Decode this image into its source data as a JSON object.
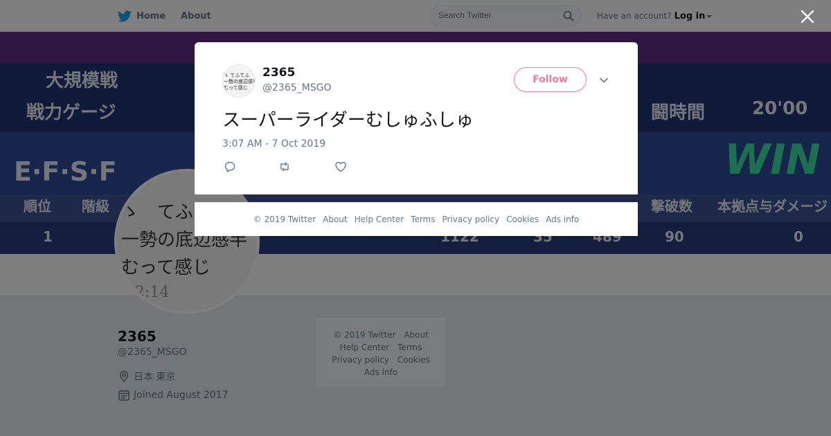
{
  "header": {
    "home_label": "Home",
    "about_label": "About",
    "search_placeholder": "Search Twitter",
    "account_prompt": "Have an account?",
    "login_label": "Log in"
  },
  "banner": {
    "texts": [
      "大規模戦",
      "戦力ゲージ",
      "E·F·S·F",
      "順位",
      "階級",
      "1",
      "闘時間",
      "20'00",
      "WIN",
      "撃破数",
      "本拠点与ダメージ",
      "90",
      "0",
      "1122",
      "35",
      "489"
    ]
  },
  "profile": {
    "name": "2365",
    "handle": "@2365_MSGO",
    "location": "日本 東京",
    "joined": "Joined August 2017",
    "avatar_lines": [
      "ゝ　てふて",
      "一勢の底辺感半",
      "むって感じ",
      "2:14"
    ]
  },
  "side_footer": {
    "copyright": "© 2019 Twitter",
    "about": "About",
    "help": "Help Center",
    "terms": "Terms",
    "privacy": "Privacy policy",
    "cookies": "Cookies",
    "ads": "Ads info"
  },
  "tweet": {
    "author_name": "2365",
    "author_handle": "@2365_MSGO",
    "follow_label": "Follow",
    "text": "スーパーライダーむしゅふしゅ",
    "timestamp": "3:07 AM - 7 Oct 2019",
    "avatar_lines": [
      "ゝ てふてふ",
      "一勢の底辺感半",
      "むって感じ"
    ]
  },
  "modal_footer": {
    "copyright": "© 2019 Twitter",
    "about": "About",
    "help": "Help Center",
    "terms": "Terms",
    "privacy": "Privacy policy",
    "cookies": "Cookies",
    "ads": "Ads info"
  },
  "colors": {
    "twitter_blue": "#1da1f2",
    "like_pink": "#e0245e",
    "muted_gray": "#657786"
  },
  "icons": {
    "logo": "twitter-bird-icon",
    "search": "search-icon",
    "close": "close-icon",
    "more": "chevron-down-icon",
    "reply": "reply-icon",
    "retweet": "retweet-icon",
    "like": "heart-icon",
    "location": "location-pin-icon",
    "joined": "calendar-icon"
  }
}
